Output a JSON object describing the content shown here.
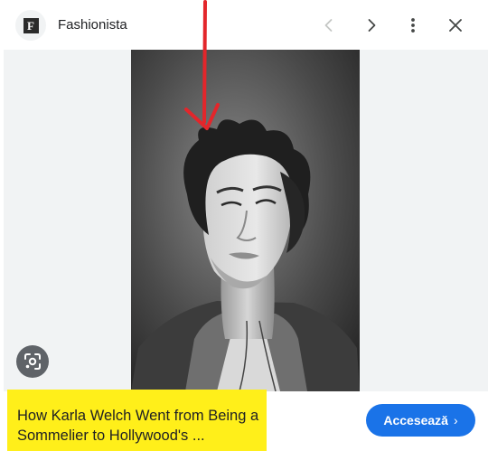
{
  "header": {
    "favicon_letter": "F",
    "site_name": "Fashionista",
    "prev_icon": "chevron-left-icon",
    "next_icon": "chevron-right-icon",
    "more_icon": "more-vertical-icon",
    "close_icon": "close-icon"
  },
  "media": {
    "photo": "black-and-white portrait",
    "lens_icon": "google-lens-icon"
  },
  "caption": {
    "line1": "How Karla Welch Went from Being a",
    "line2": "Sommelier to Hollywood's ..."
  },
  "visit_button": {
    "label": "Accesează",
    "icon": "chevron-right-icon"
  },
  "annotation": {
    "arrow_color": "#e3262b",
    "highlight_color": "#ffef1a"
  },
  "colors": {
    "accent": "#1a73e8",
    "panel_bg": "#f1f3f4",
    "text": "#202124"
  }
}
